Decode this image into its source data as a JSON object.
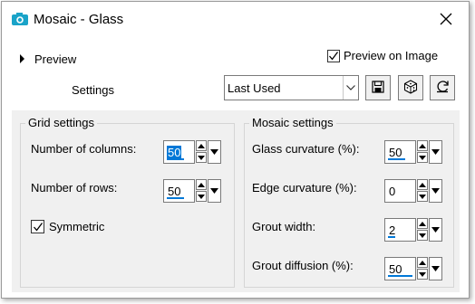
{
  "window": {
    "title": "Mosaic - Glass"
  },
  "preview": {
    "label": "Preview"
  },
  "preview_on_image": {
    "label": "Preview on Image",
    "checked": true
  },
  "settings": {
    "label": "Settings",
    "preset": "Last Used"
  },
  "toolbar": {
    "save_icon": "save-icon",
    "randomize_icon": "dice-icon",
    "reset_icon": "reset-icon"
  },
  "grid_settings": {
    "title": "Grid settings",
    "columns": {
      "label": "Number of columns:",
      "value": "50"
    },
    "rows": {
      "label": "Number of rows:",
      "value": "50"
    },
    "symmetric": {
      "label": "Symmetric",
      "checked": true
    }
  },
  "mosaic_settings": {
    "title": "Mosaic settings",
    "glass_curvature": {
      "label": "Glass curvature (%):",
      "value": "50"
    },
    "edge_curvature": {
      "label": "Edge curvature (%):",
      "value": "0"
    },
    "grout_width": {
      "label": "Grout width:",
      "value": "2"
    },
    "grout_diffusion": {
      "label": "Grout diffusion (%):",
      "value": "50"
    }
  },
  "colors": {
    "accent": "#0078d7",
    "panel": "#f0f0f0",
    "icon_teal": "#1aa3c8"
  }
}
